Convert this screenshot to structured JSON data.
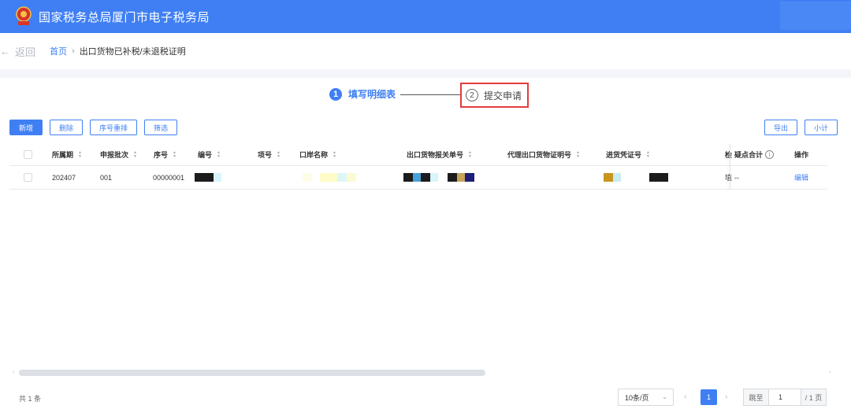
{
  "header": {
    "title": "国家税务总局厦门市电子税务局"
  },
  "nav": {
    "back_label": "返回",
    "breadcrumb_home": "首页",
    "breadcrumb_sep": "›",
    "breadcrumb_current": "出口货物已补税/未退税证明"
  },
  "steps": [
    {
      "num": "1",
      "label": "填写明细表",
      "state": "active"
    },
    {
      "num": "2",
      "label": "提交申请",
      "state": "pending"
    }
  ],
  "toolbar": {
    "add": "新增",
    "delete": "删除",
    "reorder": "序号重排",
    "filter": "筛选",
    "export": "导出",
    "subtotal": "小计"
  },
  "table": {
    "columns": {
      "period": "所属期",
      "batch": "申报批次",
      "seq": "序号",
      "code": "编号",
      "item": "项号",
      "port": "口岸名称",
      "customs_no": "出口货物报关单号",
      "agent_cert": "代理出口货物证明号",
      "purchase_cert": "进货凭证号",
      "cut_col": "检",
      "doubt_total": "疑点合计",
      "action": "操作"
    },
    "rows": [
      {
        "period": "202407",
        "batch": "001",
        "seq": "00000001",
        "cut_col": "埴",
        "doubt_total": "--",
        "action": "编辑"
      }
    ]
  },
  "footer": {
    "total": "共 1 条",
    "page_size": "10条/页",
    "prev": "‹",
    "current_page": "1",
    "next": "›",
    "jump_label": "跳至",
    "jump_value": "1",
    "total_pages": "/ 1 页"
  },
  "colors": {
    "primary": "#3f7ff3",
    "highlight_border": "#e23c3c"
  }
}
